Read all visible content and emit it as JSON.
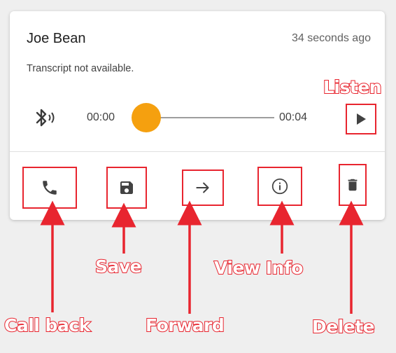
{
  "voicemail": {
    "caller_name": "Joe Bean",
    "time_ago": "34 seconds ago",
    "transcript": "Transcript not available."
  },
  "player": {
    "position": "00:00",
    "duration": "00:04",
    "progress_fraction": 0.0,
    "audio_output_icon": "bluetooth-audio-icon",
    "play_icon": "play-icon"
  },
  "actions": [
    {
      "id": "call-back",
      "icon": "phone-icon"
    },
    {
      "id": "save",
      "icon": "floppy-disk-icon"
    },
    {
      "id": "forward",
      "icon": "arrow-right-icon"
    },
    {
      "id": "view-info",
      "icon": "info-icon"
    },
    {
      "id": "delete",
      "icon": "trash-icon"
    }
  ],
  "callouts": {
    "listen": "Listen",
    "save": "Save",
    "view_info": "View Info",
    "call_back": "Call back",
    "forward": "Forward",
    "delete": "Delete"
  },
  "colors": {
    "annotation": "#e8252f",
    "slider_thumb": "#f5a00f",
    "background": "#efefef"
  }
}
